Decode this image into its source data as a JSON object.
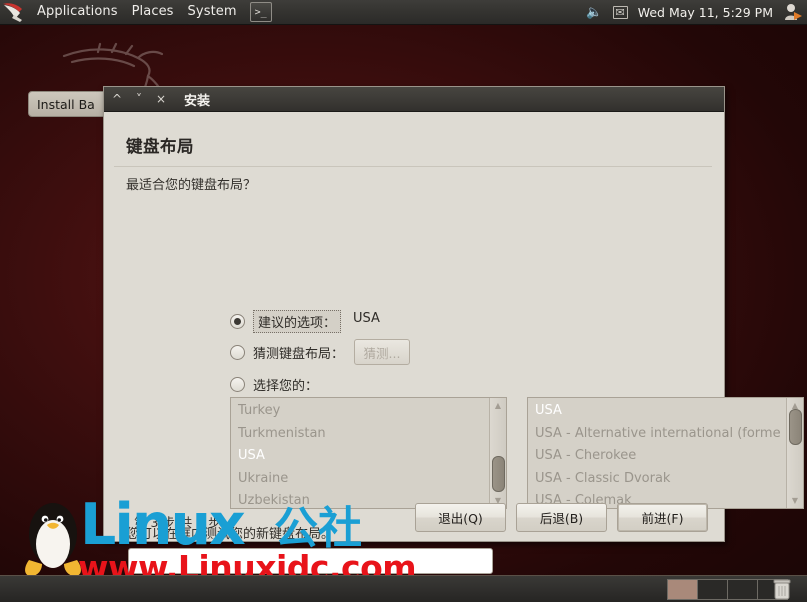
{
  "top_panel": {
    "logo_icon": "kali-dragon-logo",
    "menus": [
      "Applications",
      "Places",
      "System"
    ],
    "launcher_icon": "terminal-icon",
    "volume_icon": "speaker-icon",
    "mail_icon": "envelope-icon",
    "clock": "Wed May 11,  5:29 PM",
    "user_icon": "user-avatar-icon"
  },
  "desktop": {
    "task_button_label": "Install Ba",
    "watermark": {
      "logo_text": "Linux",
      "logo_suffix": "公社",
      "url": "www.Linuxidc.com",
      "tux_icon": "tux-penguin-icon"
    }
  },
  "bottom_panel": {
    "workspace_count": 4,
    "active_workspace": 1,
    "trash_icon": "trash-can-icon"
  },
  "dialog": {
    "title": "安装",
    "window_buttons": {
      "minimize": "^",
      "maximize": "˅",
      "close": "×"
    },
    "page_title": "键盘布局",
    "question": "最适合您的键盘布局？",
    "options": [
      {
        "label": "建议的选项：",
        "selected": true,
        "value": "USA"
      },
      {
        "label": "猜测键盘布局：",
        "selected": false,
        "button_label": "猜测..."
      },
      {
        "label": "选择您的：",
        "selected": false
      }
    ],
    "country_list": {
      "items": [
        "Turkey",
        "Turkmenistan",
        "USA",
        "Ukraine",
        "Uzbekistan"
      ],
      "selected_index": 2,
      "scroll_up_icon": "triangle-up-icon",
      "scroll_down_icon": "triangle-down-icon",
      "thumb_top_pct": 58,
      "thumb_height_pct": 30
    },
    "layout_list": {
      "items": [
        "USA",
        "USA - Alternative international (forme",
        "USA - Cherokee",
        "USA - Classic Dvorak",
        "USA - Colemak"
      ],
      "selected_index": 0,
      "scroll_up_icon": "triangle-up-icon",
      "scroll_down_icon": "triangle-down-icon",
      "thumb_top_pct": 8,
      "thumb_height_pct": 30
    },
    "test_label": "您可以在框内测试您的新键盘布局。",
    "test_input_value": "",
    "step_label": "第 3 步(共 7 步)",
    "buttons": {
      "quit": "退出(Q)",
      "back": "后退(B)",
      "forward": "前进(F)"
    }
  },
  "colors": {
    "desktop_red": "#4a1111",
    "panel_dark": "#343330",
    "dialog_bg": "#dedbd3",
    "watermark_blue": "#1a9fd4",
    "watermark_red": "#e8131a",
    "workspace_active": "#a9897a"
  }
}
